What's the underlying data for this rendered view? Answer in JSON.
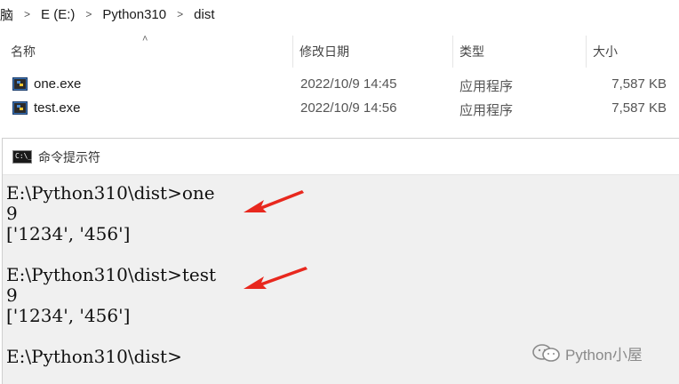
{
  "breadcrumb": {
    "items": [
      "脑",
      "E (E:)",
      "Python310",
      "dist"
    ],
    "separator": ">"
  },
  "columns": {
    "name": "名称",
    "modified": "修改日期",
    "type": "类型",
    "size": "大小"
  },
  "files": [
    {
      "name": "one.exe",
      "modified": "2022/10/9 14:45",
      "type": "应用程序",
      "size": "7,587 KB",
      "icon": "python-exe-icon"
    },
    {
      "name": "test.exe",
      "modified": "2022/10/9 14:56",
      "type": "应用程序",
      "size": "7,587 KB",
      "icon": "python-exe-icon"
    }
  ],
  "cmd": {
    "title": "命令提示符",
    "icon_label": "C:\\_",
    "lines": [
      "",
      "E:\\Python310\\dist>one",
      "9",
      "['1234', '456']",
      "",
      "E:\\Python310\\dist>test",
      "9",
      "['1234', '456']",
      "",
      "E:\\Python310\\dist>"
    ]
  },
  "annotation_color": "#e8281e",
  "watermark": {
    "text": "Python小屋",
    "icon": "wechat-icon"
  }
}
